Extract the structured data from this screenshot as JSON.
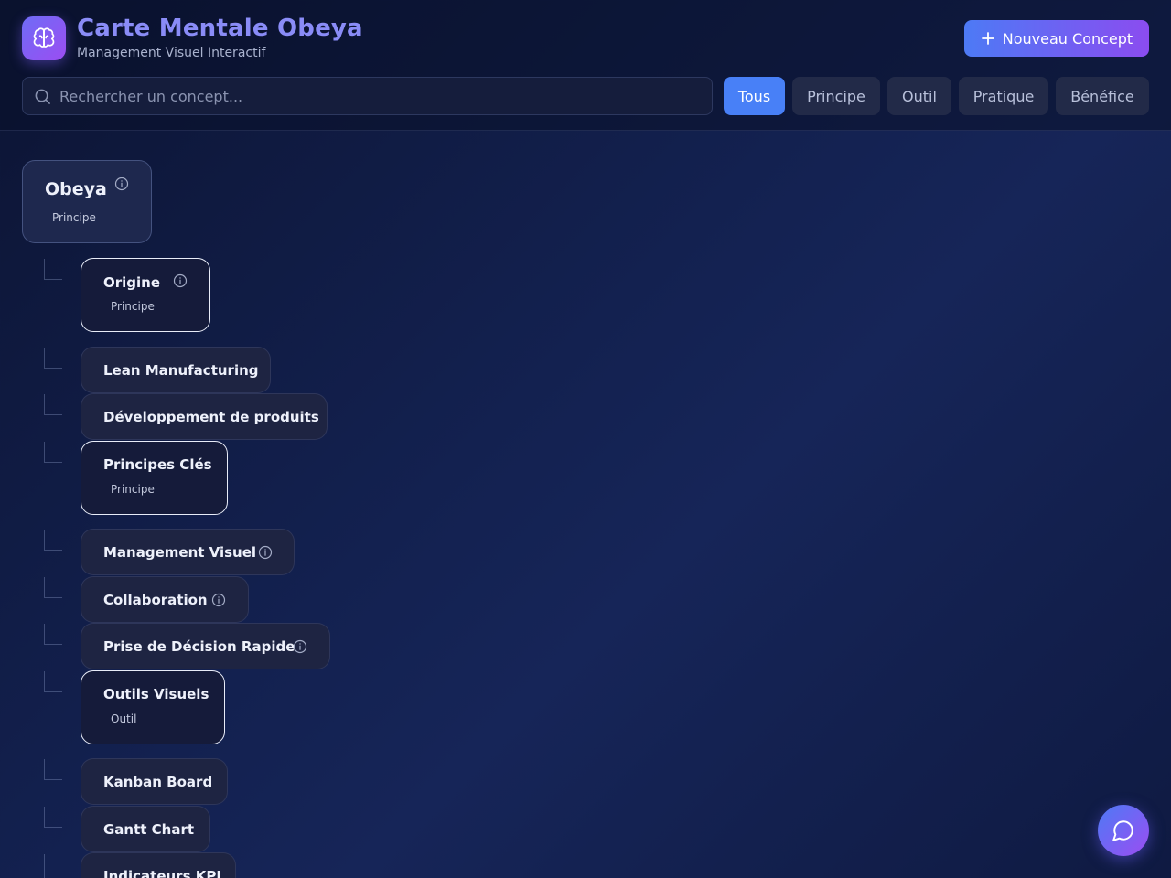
{
  "header": {
    "title": "Carte Mentale Obeya",
    "subtitle": "Management Visuel Interactif",
    "new_button_label": "Nouveau Concept",
    "logo_icon": "brain-icon"
  },
  "search": {
    "placeholder": "Rechercher un concept...",
    "value": ""
  },
  "filters": [
    {
      "label": "Tous",
      "active": true
    },
    {
      "label": "Principe",
      "active": false
    },
    {
      "label": "Outil",
      "active": false
    },
    {
      "label": "Pratique",
      "active": false
    },
    {
      "label": "Bénéfice",
      "active": false
    }
  ],
  "tree": {
    "root": {
      "label": "Obeya",
      "tag": "Principe",
      "has_info": true
    },
    "nodes": [
      {
        "label": "Origine",
        "tag": "Principe",
        "has_info": true
      },
      {
        "label": "Lean Manufacturing",
        "tag": "",
        "has_info": false
      },
      {
        "label": "Développement de produits",
        "tag": "",
        "has_info": false
      },
      {
        "label": "Principes Clés",
        "tag": "Principe",
        "has_info": false
      },
      {
        "label": "Management Visuel",
        "tag": "",
        "has_info": true
      },
      {
        "label": "Collaboration",
        "tag": "",
        "has_info": true
      },
      {
        "label": "Prise de Décision Rapide",
        "tag": "",
        "has_info": true
      },
      {
        "label": "Outils Visuels",
        "tag": "Outil",
        "has_info": false
      },
      {
        "label": "Kanban Board",
        "tag": "",
        "has_info": false
      },
      {
        "label": "Gantt Chart",
        "tag": "",
        "has_info": false
      },
      {
        "label": "Indicateurs KPI",
        "tag": "",
        "has_info": false
      }
    ]
  },
  "chat_button": {
    "icon": "chat-bubble-icon"
  },
  "colors": {
    "accent_blue": "#4880f7",
    "accent_purple": "#8b4cf0",
    "title_color": "#8a8cf7"
  }
}
